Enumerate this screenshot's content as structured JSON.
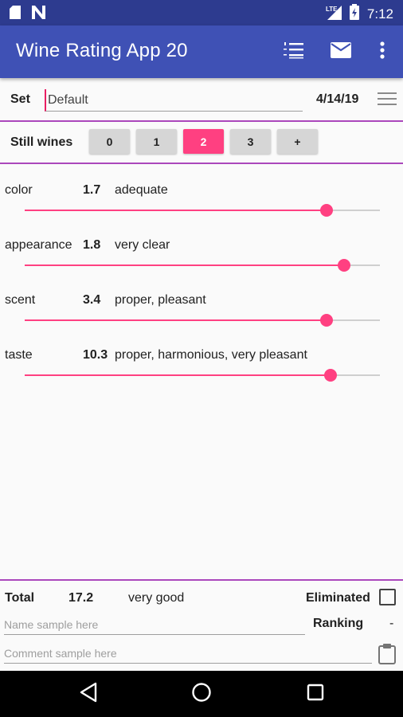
{
  "status_bar": {
    "time": "7:12",
    "network": "LTE",
    "icons": [
      "sd-card-icon",
      "n-notification-icon",
      "lte-signal-icon",
      "battery-icon"
    ]
  },
  "app_bar": {
    "title": "Wine Rating App 20",
    "actions": [
      "list-icon",
      "mail-icon",
      "more-vert-icon"
    ]
  },
  "set_row": {
    "label": "Set",
    "value": "Default",
    "date": "4/14/19"
  },
  "still_wines": {
    "label": "Still wines",
    "buttons": [
      "0",
      "1",
      "2",
      "3",
      "+"
    ],
    "selected": "2"
  },
  "criteria": [
    {
      "name": "color",
      "value": "1.7",
      "description": "adequate",
      "level": 0.85
    },
    {
      "name": "appearance",
      "value": "1.8",
      "description": "very clear",
      "level": 0.9
    },
    {
      "name": "scent",
      "value": "3.4",
      "description": "proper, pleasant",
      "level": 0.85
    },
    {
      "name": "taste",
      "value": "10.3",
      "description": "proper, harmonious, very pleasant",
      "level": 0.86
    }
  ],
  "summary": {
    "total_label": "Total",
    "total_value": "17.2",
    "total_description": "very good",
    "eliminated_label": "Eliminated",
    "name_placeholder": "Name sample here",
    "ranking_label": "Ranking",
    "ranking_value": "-",
    "comment_placeholder": "Comment sample here"
  },
  "colors": {
    "primary": "#3f51b5",
    "primary_dark": "#2d3b8f",
    "accent": "#ff4081",
    "divider": "#ab47bc"
  }
}
